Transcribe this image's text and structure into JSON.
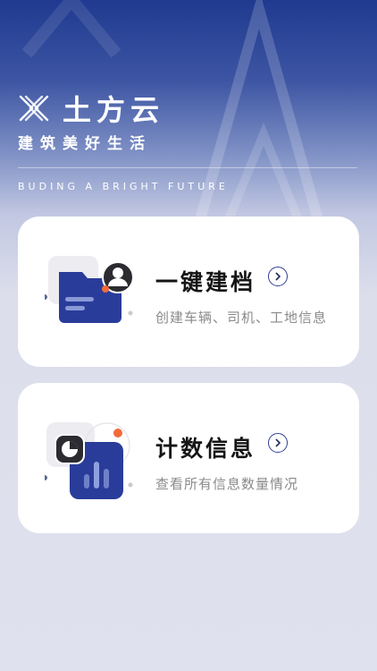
{
  "header": {
    "app_title": "土方云",
    "slogan": "建筑美好生活",
    "tagline": "BUDING A BRIGHT FUTURE"
  },
  "cards": [
    {
      "title": "一键建档",
      "description": "创建车辆、司机、工地信息",
      "icon": "folder-user-icon"
    },
    {
      "title": "计数信息",
      "description": "查看所有信息数量情况",
      "icon": "chart-stats-icon"
    }
  ],
  "colors": {
    "primary": "#2a3c9a",
    "accent": "#f26b3a",
    "background": "#dfe1ee"
  }
}
